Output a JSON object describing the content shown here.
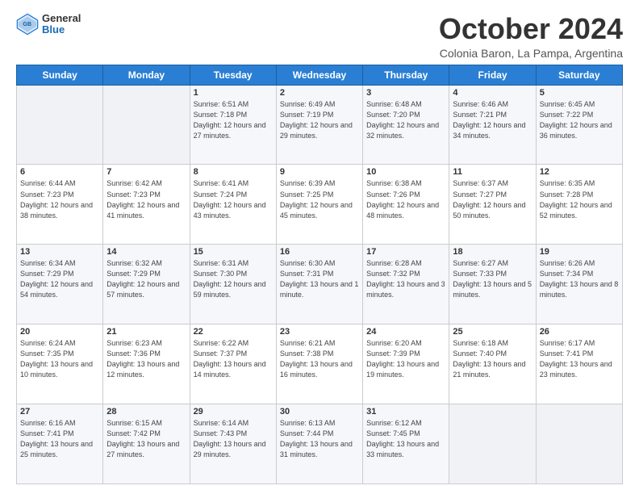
{
  "logo": {
    "general": "General",
    "blue": "Blue"
  },
  "header": {
    "title": "October 2024",
    "subtitle": "Colonia Baron, La Pampa, Argentina"
  },
  "weekdays": [
    "Sunday",
    "Monday",
    "Tuesday",
    "Wednesday",
    "Thursday",
    "Friday",
    "Saturday"
  ],
  "weeks": [
    [
      {
        "day": "",
        "sunrise": "",
        "sunset": "",
        "daylight": ""
      },
      {
        "day": "",
        "sunrise": "",
        "sunset": "",
        "daylight": ""
      },
      {
        "day": "1",
        "sunrise": "Sunrise: 6:51 AM",
        "sunset": "Sunset: 7:18 PM",
        "daylight": "Daylight: 12 hours and 27 minutes."
      },
      {
        "day": "2",
        "sunrise": "Sunrise: 6:49 AM",
        "sunset": "Sunset: 7:19 PM",
        "daylight": "Daylight: 12 hours and 29 minutes."
      },
      {
        "day": "3",
        "sunrise": "Sunrise: 6:48 AM",
        "sunset": "Sunset: 7:20 PM",
        "daylight": "Daylight: 12 hours and 32 minutes."
      },
      {
        "day": "4",
        "sunrise": "Sunrise: 6:46 AM",
        "sunset": "Sunset: 7:21 PM",
        "daylight": "Daylight: 12 hours and 34 minutes."
      },
      {
        "day": "5",
        "sunrise": "Sunrise: 6:45 AM",
        "sunset": "Sunset: 7:22 PM",
        "daylight": "Daylight: 12 hours and 36 minutes."
      }
    ],
    [
      {
        "day": "6",
        "sunrise": "Sunrise: 6:44 AM",
        "sunset": "Sunset: 7:23 PM",
        "daylight": "Daylight: 12 hours and 38 minutes."
      },
      {
        "day": "7",
        "sunrise": "Sunrise: 6:42 AM",
        "sunset": "Sunset: 7:23 PM",
        "daylight": "Daylight: 12 hours and 41 minutes."
      },
      {
        "day": "8",
        "sunrise": "Sunrise: 6:41 AM",
        "sunset": "Sunset: 7:24 PM",
        "daylight": "Daylight: 12 hours and 43 minutes."
      },
      {
        "day": "9",
        "sunrise": "Sunrise: 6:39 AM",
        "sunset": "Sunset: 7:25 PM",
        "daylight": "Daylight: 12 hours and 45 minutes."
      },
      {
        "day": "10",
        "sunrise": "Sunrise: 6:38 AM",
        "sunset": "Sunset: 7:26 PM",
        "daylight": "Daylight: 12 hours and 48 minutes."
      },
      {
        "day": "11",
        "sunrise": "Sunrise: 6:37 AM",
        "sunset": "Sunset: 7:27 PM",
        "daylight": "Daylight: 12 hours and 50 minutes."
      },
      {
        "day": "12",
        "sunrise": "Sunrise: 6:35 AM",
        "sunset": "Sunset: 7:28 PM",
        "daylight": "Daylight: 12 hours and 52 minutes."
      }
    ],
    [
      {
        "day": "13",
        "sunrise": "Sunrise: 6:34 AM",
        "sunset": "Sunset: 7:29 PM",
        "daylight": "Daylight: 12 hours and 54 minutes."
      },
      {
        "day": "14",
        "sunrise": "Sunrise: 6:32 AM",
        "sunset": "Sunset: 7:29 PM",
        "daylight": "Daylight: 12 hours and 57 minutes."
      },
      {
        "day": "15",
        "sunrise": "Sunrise: 6:31 AM",
        "sunset": "Sunset: 7:30 PM",
        "daylight": "Daylight: 12 hours and 59 minutes."
      },
      {
        "day": "16",
        "sunrise": "Sunrise: 6:30 AM",
        "sunset": "Sunset: 7:31 PM",
        "daylight": "Daylight: 13 hours and 1 minute."
      },
      {
        "day": "17",
        "sunrise": "Sunrise: 6:28 AM",
        "sunset": "Sunset: 7:32 PM",
        "daylight": "Daylight: 13 hours and 3 minutes."
      },
      {
        "day": "18",
        "sunrise": "Sunrise: 6:27 AM",
        "sunset": "Sunset: 7:33 PM",
        "daylight": "Daylight: 13 hours and 5 minutes."
      },
      {
        "day": "19",
        "sunrise": "Sunrise: 6:26 AM",
        "sunset": "Sunset: 7:34 PM",
        "daylight": "Daylight: 13 hours and 8 minutes."
      }
    ],
    [
      {
        "day": "20",
        "sunrise": "Sunrise: 6:24 AM",
        "sunset": "Sunset: 7:35 PM",
        "daylight": "Daylight: 13 hours and 10 minutes."
      },
      {
        "day": "21",
        "sunrise": "Sunrise: 6:23 AM",
        "sunset": "Sunset: 7:36 PM",
        "daylight": "Daylight: 13 hours and 12 minutes."
      },
      {
        "day": "22",
        "sunrise": "Sunrise: 6:22 AM",
        "sunset": "Sunset: 7:37 PM",
        "daylight": "Daylight: 13 hours and 14 minutes."
      },
      {
        "day": "23",
        "sunrise": "Sunrise: 6:21 AM",
        "sunset": "Sunset: 7:38 PM",
        "daylight": "Daylight: 13 hours and 16 minutes."
      },
      {
        "day": "24",
        "sunrise": "Sunrise: 6:20 AM",
        "sunset": "Sunset: 7:39 PM",
        "daylight": "Daylight: 13 hours and 19 minutes."
      },
      {
        "day": "25",
        "sunrise": "Sunrise: 6:18 AM",
        "sunset": "Sunset: 7:40 PM",
        "daylight": "Daylight: 13 hours and 21 minutes."
      },
      {
        "day": "26",
        "sunrise": "Sunrise: 6:17 AM",
        "sunset": "Sunset: 7:41 PM",
        "daylight": "Daylight: 13 hours and 23 minutes."
      }
    ],
    [
      {
        "day": "27",
        "sunrise": "Sunrise: 6:16 AM",
        "sunset": "Sunset: 7:41 PM",
        "daylight": "Daylight: 13 hours and 25 minutes."
      },
      {
        "day": "28",
        "sunrise": "Sunrise: 6:15 AM",
        "sunset": "Sunset: 7:42 PM",
        "daylight": "Daylight: 13 hours and 27 minutes."
      },
      {
        "day": "29",
        "sunrise": "Sunrise: 6:14 AM",
        "sunset": "Sunset: 7:43 PM",
        "daylight": "Daylight: 13 hours and 29 minutes."
      },
      {
        "day": "30",
        "sunrise": "Sunrise: 6:13 AM",
        "sunset": "Sunset: 7:44 PM",
        "daylight": "Daylight: 13 hours and 31 minutes."
      },
      {
        "day": "31",
        "sunrise": "Sunrise: 6:12 AM",
        "sunset": "Sunset: 7:45 PM",
        "daylight": "Daylight: 13 hours and 33 minutes."
      },
      {
        "day": "",
        "sunrise": "",
        "sunset": "",
        "daylight": ""
      },
      {
        "day": "",
        "sunrise": "",
        "sunset": "",
        "daylight": ""
      }
    ]
  ]
}
